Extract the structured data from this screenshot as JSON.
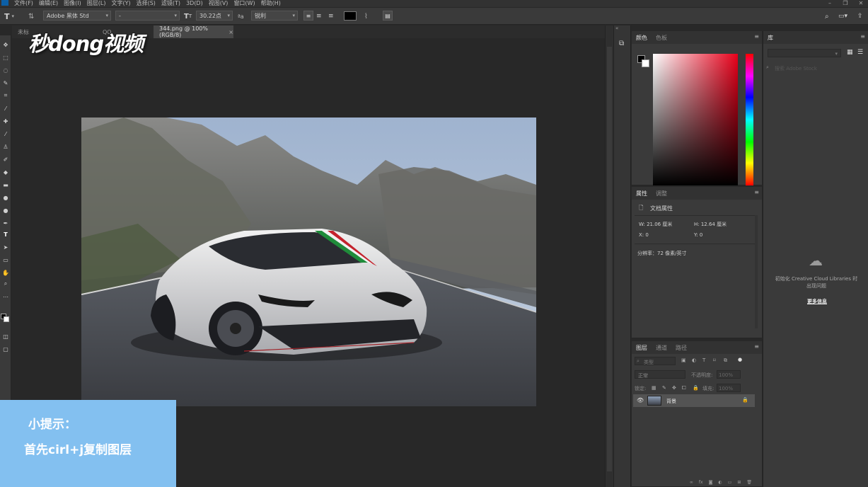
{
  "menubar": {
    "items": [
      "文件(F)",
      "编辑(E)",
      "图像(I)",
      "图层(L)",
      "文字(Y)",
      "选择(S)",
      "滤镜(T)",
      "3D(D)",
      "视图(V)",
      "窗口(W)",
      "帮助(H)"
    ]
  },
  "options": {
    "tool_glyph": "T",
    "font_family": "Adobe 黑体 Std",
    "font_style": "-",
    "font_size": "30.22点",
    "antialias": "锐利"
  },
  "tabs": [
    {
      "label": "未标"
    },
    {
      "label": "QQ"
    },
    {
      "label": "344.png @ 100%(RGB/8)"
    }
  ],
  "color_panel": {
    "tabs": [
      "颜色",
      "色板"
    ]
  },
  "properties_panel": {
    "tabs": [
      "属性",
      "调整"
    ],
    "doc_label": "文档属性",
    "width": "W:  21.06 厘米",
    "height": "H:  12.64 厘米",
    "x": "X:  0",
    "y": "Y:  0",
    "resolution": "分辨率：72 像素/英寸"
  },
  "layers_panel": {
    "tabs": [
      "图层",
      "通道",
      "路径"
    ],
    "filter_label": "类型",
    "blend_mode": "正常",
    "opacity_label": "不透明度:",
    "opacity_value": "100%",
    "lock_label": "锁定:",
    "fill_label": "填充:",
    "fill_value": "100%",
    "layer_name": "背景"
  },
  "libraries_panel": {
    "tab": "库",
    "search_placeholder": "搜索 Adobe Stock",
    "message": "初始化 Creative Cloud Libraries 时出现问题",
    "more_info": "更多信息"
  },
  "watermark": {
    "logo": "秒dong视频"
  },
  "tip": {
    "title": "小提示：",
    "body": "首先cirl+j复制图层"
  }
}
